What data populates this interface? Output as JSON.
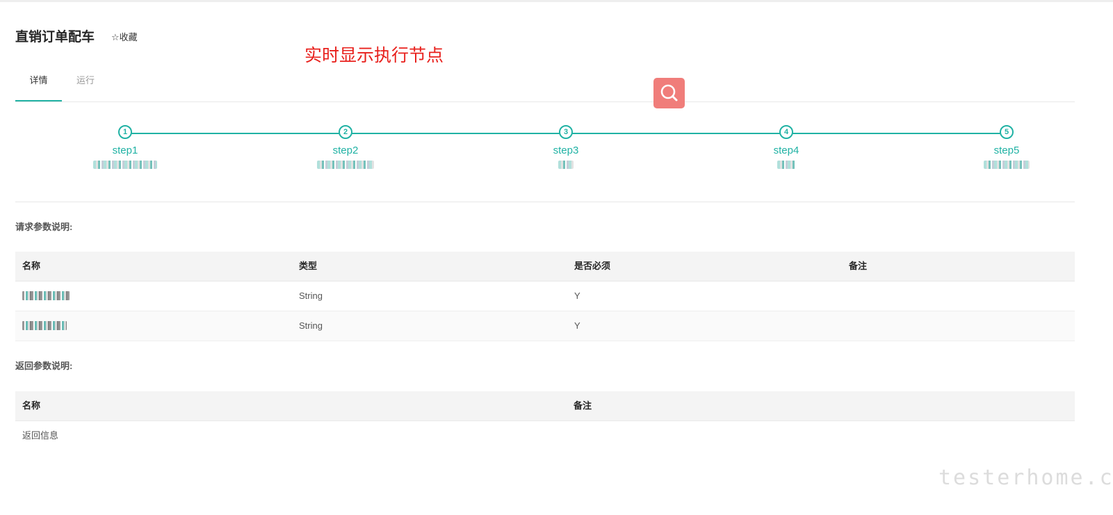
{
  "header": {
    "title": "直销订单配车",
    "favorite_label": "☆收藏"
  },
  "annotation": "实时显示执行节点",
  "tabs": [
    {
      "label": "详情",
      "active": true
    },
    {
      "label": "运行",
      "active": false
    }
  ],
  "search_button": {
    "icon": "search-icon",
    "color": "#f07d7a"
  },
  "steps": [
    {
      "number": "1",
      "label": "step1"
    },
    {
      "number": "2",
      "label": "step2"
    },
    {
      "number": "3",
      "label": "step3"
    },
    {
      "number": "4",
      "label": "step4"
    },
    {
      "number": "5",
      "label": "step5"
    }
  ],
  "request_params": {
    "title": "请求参数说明:",
    "columns": [
      "名称",
      "类型",
      "是否必须",
      "备注"
    ],
    "rows": [
      {
        "type": "String",
        "required": "Y",
        "remark": ""
      },
      {
        "type": "String",
        "required": "Y",
        "remark": ""
      }
    ]
  },
  "return_params": {
    "title": "返回参数说明:",
    "columns": [
      "名称",
      "备注"
    ],
    "rows": [
      {
        "name": "返回信息",
        "remark": ""
      }
    ]
  },
  "watermark": "testerhome.com",
  "colors": {
    "accent": "#20b2a4",
    "annotation": "#e8201c",
    "search_button": "#f07d7a"
  }
}
